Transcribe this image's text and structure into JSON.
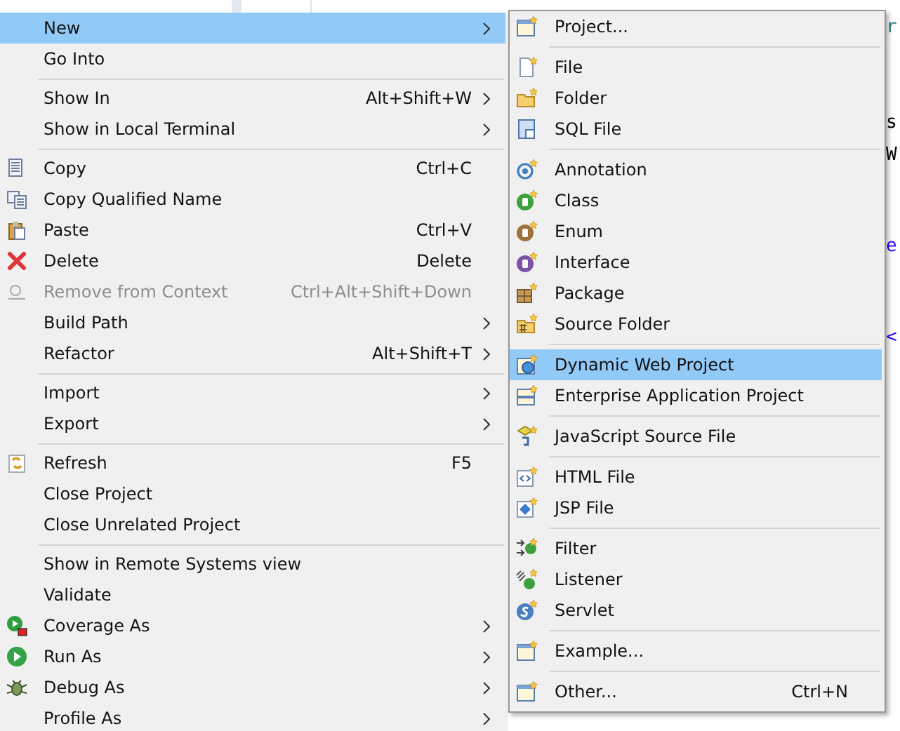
{
  "editor": {
    "fragments": [
      {
        "text": "r",
        "kind": "type"
      },
      {
        "text": "s",
        "kind": "plain"
      },
      {
        "text": "W",
        "kind": "plain"
      },
      {
        "text": "e",
        "kind": "link"
      },
      {
        "text": "<",
        "kind": "link"
      }
    ]
  },
  "menu": {
    "items": [
      {
        "kind": "item",
        "label": "New",
        "submenu": true,
        "selected": true,
        "disabled": false
      },
      {
        "kind": "item",
        "label": "Go Into",
        "submenu": false,
        "selected": false,
        "disabled": false
      },
      {
        "kind": "separator"
      },
      {
        "kind": "item",
        "label": "Show In",
        "shortcut": "Alt+Shift+W",
        "submenu": true,
        "selected": false,
        "disabled": false
      },
      {
        "kind": "item",
        "label": "Show in Local Terminal",
        "submenu": true,
        "selected": false,
        "disabled": false
      },
      {
        "kind": "separator"
      },
      {
        "kind": "item",
        "label": "Copy",
        "shortcut": "Ctrl+C",
        "submenu": false,
        "selected": false,
        "disabled": false
      },
      {
        "kind": "item",
        "label": "Copy Qualified Name",
        "submenu": false,
        "selected": false,
        "disabled": false
      },
      {
        "kind": "item",
        "label": "Paste",
        "shortcut": "Ctrl+V",
        "submenu": false,
        "selected": false,
        "disabled": false
      },
      {
        "kind": "item",
        "label": "Delete",
        "shortcut": "Delete",
        "submenu": false,
        "selected": false,
        "disabled": false
      },
      {
        "kind": "item",
        "label": "Remove from Context",
        "shortcut": "Ctrl+Alt+Shift+Down",
        "submenu": false,
        "selected": false,
        "disabled": true
      },
      {
        "kind": "item",
        "label": "Build Path",
        "submenu": true,
        "selected": false,
        "disabled": false
      },
      {
        "kind": "item",
        "label": "Refactor",
        "shortcut": "Alt+Shift+T",
        "submenu": true,
        "selected": false,
        "disabled": false
      },
      {
        "kind": "separator"
      },
      {
        "kind": "item",
        "label": "Import",
        "submenu": true,
        "selected": false,
        "disabled": false
      },
      {
        "kind": "item",
        "label": "Export",
        "submenu": true,
        "selected": false,
        "disabled": false
      },
      {
        "kind": "separator"
      },
      {
        "kind": "item",
        "label": "Refresh",
        "shortcut": "F5",
        "submenu": false,
        "selected": false,
        "disabled": false
      },
      {
        "kind": "item",
        "label": "Close Project",
        "submenu": false,
        "selected": false,
        "disabled": false
      },
      {
        "kind": "item",
        "label": "Close Unrelated Project",
        "submenu": false,
        "selected": false,
        "disabled": false
      },
      {
        "kind": "separator"
      },
      {
        "kind": "item",
        "label": "Show in Remote Systems view",
        "submenu": false,
        "selected": false,
        "disabled": false
      },
      {
        "kind": "item",
        "label": "Validate",
        "submenu": false,
        "selected": false,
        "disabled": false
      },
      {
        "kind": "item",
        "label": "Coverage As",
        "submenu": true,
        "selected": false,
        "disabled": false
      },
      {
        "kind": "item",
        "label": "Run As",
        "submenu": true,
        "selected": false,
        "disabled": false
      },
      {
        "kind": "item",
        "label": "Debug As",
        "submenu": true,
        "selected": false,
        "disabled": false
      },
      {
        "kind": "item",
        "label": "Profile As",
        "submenu": true,
        "selected": false,
        "disabled": false
      }
    ]
  },
  "submenu": {
    "items": [
      {
        "kind": "item",
        "label": "Project...",
        "selected": false
      },
      {
        "kind": "separator"
      },
      {
        "kind": "item",
        "label": "File",
        "selected": false
      },
      {
        "kind": "item",
        "label": "Folder",
        "selected": false
      },
      {
        "kind": "item",
        "label": "SQL File",
        "selected": false
      },
      {
        "kind": "separator"
      },
      {
        "kind": "item",
        "label": "Annotation",
        "selected": false
      },
      {
        "kind": "item",
        "label": "Class",
        "selected": false
      },
      {
        "kind": "item",
        "label": "Enum",
        "selected": false
      },
      {
        "kind": "item",
        "label": "Interface",
        "selected": false
      },
      {
        "kind": "item",
        "label": "Package",
        "selected": false
      },
      {
        "kind": "item",
        "label": "Source Folder",
        "selected": false
      },
      {
        "kind": "separator"
      },
      {
        "kind": "item",
        "label": "Dynamic Web Project",
        "selected": true
      },
      {
        "kind": "item",
        "label": "Enterprise Application Project",
        "selected": false
      },
      {
        "kind": "separator"
      },
      {
        "kind": "item",
        "label": "JavaScript Source File",
        "selected": false
      },
      {
        "kind": "separator"
      },
      {
        "kind": "item",
        "label": "HTML File",
        "selected": false
      },
      {
        "kind": "item",
        "label": "JSP File",
        "selected": false
      },
      {
        "kind": "separator"
      },
      {
        "kind": "item",
        "label": "Filter",
        "selected": false
      },
      {
        "kind": "item",
        "label": "Listener",
        "selected": false
      },
      {
        "kind": "item",
        "label": "Servlet",
        "selected": false
      },
      {
        "kind": "separator"
      },
      {
        "kind": "item",
        "label": "Example...",
        "selected": false
      },
      {
        "kind": "separator"
      },
      {
        "kind": "item",
        "label": "Other...",
        "shortcut": "Ctrl+N",
        "selected": false
      }
    ]
  }
}
